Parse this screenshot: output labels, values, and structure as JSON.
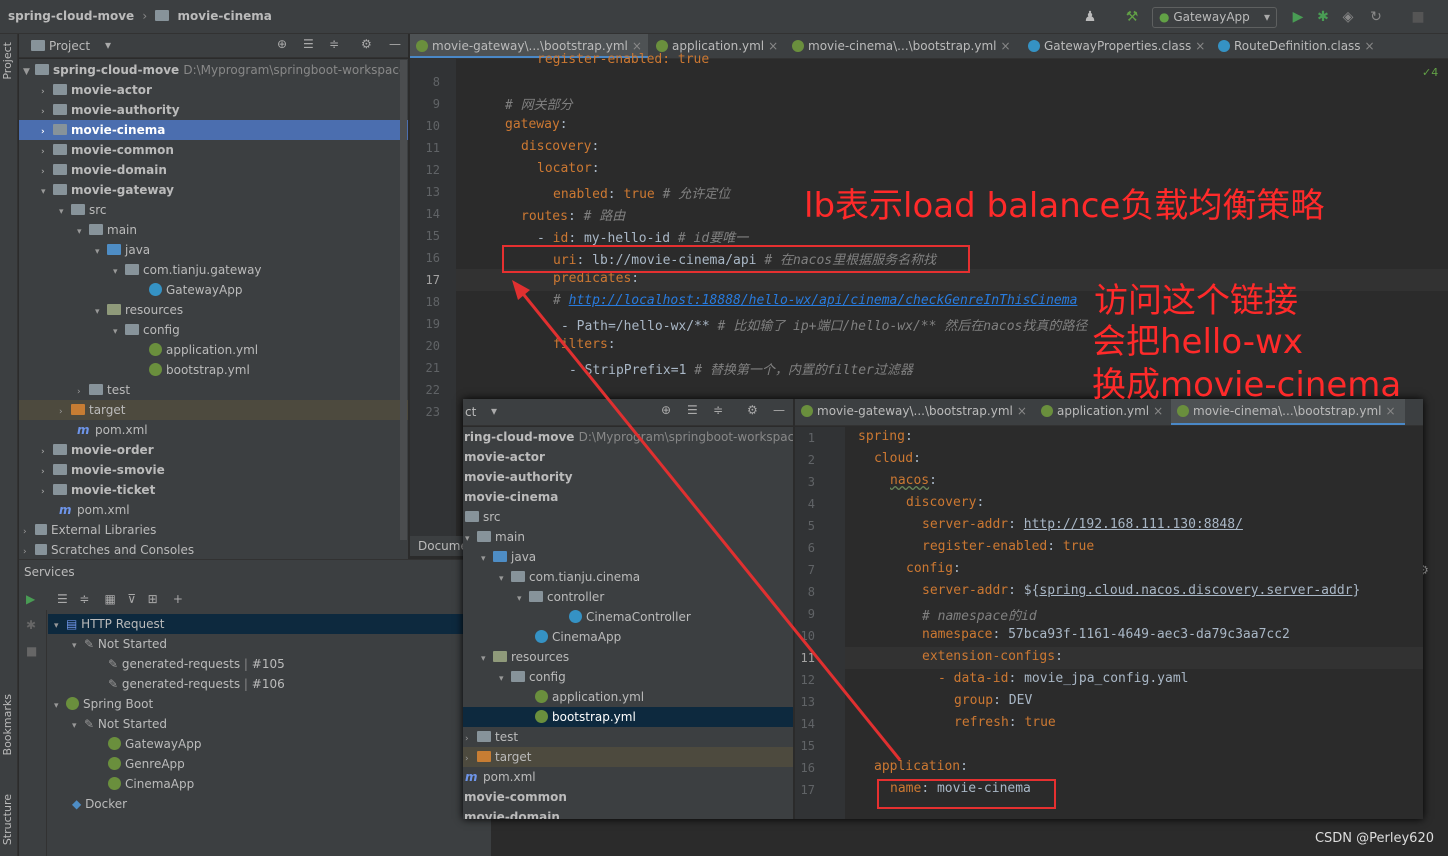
{
  "breadcrumb": {
    "project": "spring-cloud-move",
    "module": "movie-cinema"
  },
  "toolbar": {
    "run_config": "GatewayApp"
  },
  "left_strip": {
    "project": "Project",
    "bookmarks": "Bookmarks",
    "structure": "Structure"
  },
  "project_panel": {
    "title": "Project",
    "tree": [
      {
        "label": "spring-cloud-move",
        "path": "D:\\Myprogram\\springboot-workspace"
      },
      {
        "label": "movie-actor"
      },
      {
        "label": "movie-authority"
      },
      {
        "label": "movie-cinema"
      },
      {
        "label": "movie-common"
      },
      {
        "label": "movie-domain"
      },
      {
        "label": "movie-gateway"
      },
      {
        "label": "src"
      },
      {
        "label": "main"
      },
      {
        "label": "java"
      },
      {
        "label": "com.tianju.gateway"
      },
      {
        "label": "GatewayApp"
      },
      {
        "label": "resources"
      },
      {
        "label": "config"
      },
      {
        "label": "application.yml"
      },
      {
        "label": "bootstrap.yml"
      },
      {
        "label": "test"
      },
      {
        "label": "target"
      },
      {
        "label": "pom.xml"
      },
      {
        "label": "movie-order"
      },
      {
        "label": "movie-smovie"
      },
      {
        "label": "movie-ticket"
      },
      {
        "label": "pom.xml"
      },
      {
        "label": "External Libraries"
      },
      {
        "label": "Scratches and Consoles"
      }
    ]
  },
  "editor_tabs": [
    {
      "label": "movie-gateway\\...\\bootstrap.yml"
    },
    {
      "label": "application.yml"
    },
    {
      "label": "movie-cinema\\...\\bootstrap.yml"
    },
    {
      "label": "GatewayProperties.class"
    },
    {
      "label": "RouteDefinition.class"
    }
  ],
  "editor": {
    "line_numbers": [
      "8",
      "9",
      "10",
      "11",
      "12",
      "13",
      "14",
      "15",
      "16",
      "17",
      "18",
      "19",
      "20",
      "21",
      "22",
      "23"
    ],
    "lines": {
      "l8": "register-enabled: true",
      "l9": "# 网关部分",
      "l10": "gateway",
      "l11": "discovery",
      "l12": "locator",
      "l13_key": "enabled",
      "l13_val": "true",
      "l13_c": "# 允许定位",
      "l14_key": "routes",
      "l14_c": "# 路由",
      "l15_key": "id",
      "l15_val": "my-hello-id",
      "l15_c": "# id要唯一",
      "l16_key": "uri",
      "l16_val": "lb://movie-cinema/api",
      "l16_c": "# 在nacos里根据服务名称找",
      "l17": "predicates",
      "l18_c": "# ",
      "l18_url": "http://localhost:18888/hello-wx/api/cinema/checkGenreInThisCinema",
      "l19_val": "- Path=/hello-wx/**",
      "l19_c": "# 比如输了 ip+端口/hello-wx/** 然后在nacos找真的路径",
      "l20": "filters",
      "l21_val": "- StripPrefix=1",
      "l21_c": "# 替换第一个，内置的filter过滤器"
    }
  },
  "annotations": {
    "lb": "lb表示load balance负载均衡策略",
    "visit1": "访问这个链接",
    "visit2": "会把hello-wx",
    "visit3": "换成movie-cinema"
  },
  "documentation_tab": "Documentation",
  "services": {
    "title": "Services",
    "items": [
      {
        "label": "HTTP Request"
      },
      {
        "label": "Not Started"
      },
      {
        "label": "generated-requests",
        "suffix": "#105"
      },
      {
        "label": "generated-requests",
        "suffix": "#106"
      },
      {
        "label": "Spring Boot"
      },
      {
        "label": "Not Started"
      },
      {
        "label": "GatewayApp"
      },
      {
        "label": "GenreApp"
      },
      {
        "label": "CinemaApp"
      },
      {
        "label": "Docker"
      }
    ]
  },
  "overlay": {
    "header_fragment": "ct",
    "tree": [
      {
        "label": "ring-cloud-move",
        "path": "D:\\Myprogram\\springboot-workspace"
      },
      {
        "label": "movie-actor"
      },
      {
        "label": "movie-authority"
      },
      {
        "label": "movie-cinema"
      },
      {
        "label": "src"
      },
      {
        "label": "main"
      },
      {
        "label": "java"
      },
      {
        "label": "com.tianju.cinema"
      },
      {
        "label": "controller"
      },
      {
        "label": "CinemaController"
      },
      {
        "label": "CinemaApp"
      },
      {
        "label": "resources"
      },
      {
        "label": "config"
      },
      {
        "label": "application.yml"
      },
      {
        "label": "bootstrap.yml"
      },
      {
        "label": "test"
      },
      {
        "label": "target"
      },
      {
        "label": "pom.xml"
      },
      {
        "label": "movie-common"
      },
      {
        "label": "movie-domain"
      }
    ],
    "tabs": [
      {
        "label": "movie-gateway\\...\\bootstrap.yml"
      },
      {
        "label": "application.yml"
      },
      {
        "label": "movie-cinema\\...\\bootstrap.yml"
      }
    ],
    "line_numbers": [
      "1",
      "2",
      "3",
      "4",
      "5",
      "6",
      "7",
      "8",
      "9",
      "10",
      "11",
      "12",
      "13",
      "14",
      "15",
      "16",
      "17"
    ],
    "lines": {
      "l1": "spring",
      "l2": "cloud",
      "l3": "nacos",
      "l4": "discovery",
      "l5_key": "server-addr",
      "l5_val": "http://192.168.111.130:8848/",
      "l6_key": "register-enabled",
      "l6_val": "true",
      "l7": "config",
      "l8_key": "server-addr",
      "l8_pre": "${",
      "l8_val": "spring.cloud.nacos.discovery.server-addr",
      "l8_post": "}",
      "l9_c": "# namespace的id",
      "l10_key": "namespace",
      "l10_val": "57bca93f-1161-4649-aec3-da79c3aa7cc2",
      "l11": "extension-configs",
      "l12_key": "- data-id",
      "l12_val": "movie_jpa_config.yaml",
      "l13_key": "group",
      "l13_val": "DEV",
      "l14_key": "refresh",
      "l14_val": "true",
      "l16": "application",
      "l17_key": "name",
      "l17_val": "movie-cinema"
    }
  },
  "watermark": "CSDN @Perley620",
  "colors": {
    "accent": "#4a88c7",
    "selection": "#4b6eaf",
    "annotation": "#ff2a2a",
    "arrow": "#e03030"
  }
}
